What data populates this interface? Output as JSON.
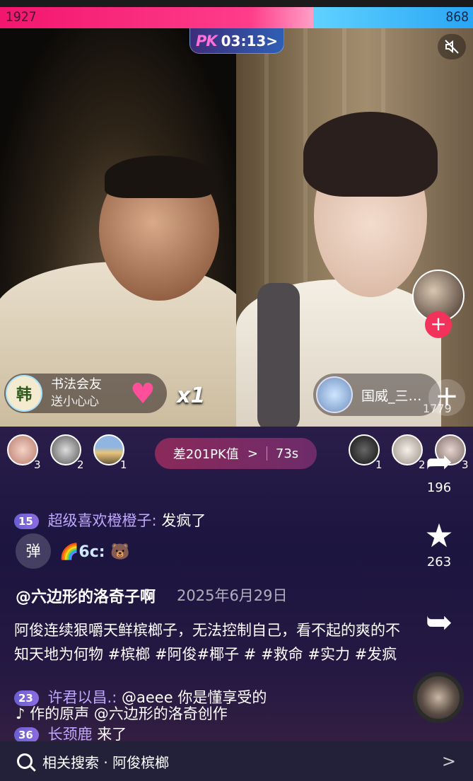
{
  "pk": {
    "left_score": "1927",
    "right_score": "868",
    "logo": "PK",
    "timer": "03:13>",
    "left_ratio": 0.662
  },
  "left_anchor": {
    "gift_sender": "书法会友",
    "gift_action": "送小心心",
    "gift_avatar_glyph": "韩",
    "gift_icon": "heart-gift-icon",
    "gift_count": "x1"
  },
  "right_anchor": {
    "name": "国威_三…",
    "side_count": "1779"
  },
  "fans": {
    "left": [
      {
        "rank": "3"
      },
      {
        "rank": "2"
      },
      {
        "rank": "1"
      }
    ],
    "right": [
      {
        "rank": "1"
      },
      {
        "rank": "2"
      },
      {
        "rank": "3"
      }
    ]
  },
  "pk_diff": {
    "text": "差201PK值",
    "chevron": ">",
    "countdown": "73s"
  },
  "comments": [
    {
      "level": "15",
      "user": "超级喜欢橙橙子:",
      "msg": "发疯了"
    },
    {
      "level": "23",
      "user": "许君以昌.:",
      "msg": "@aeee 你是懂享受的"
    },
    {
      "level": "36",
      "user": "长颈鹿",
      "msg": "来了"
    }
  ],
  "danmu_button": "弹",
  "emoji_line": "🌈6c: 🐻",
  "caption": {
    "author": "@六边形的洛奇子啊",
    "date": "2025年6月29日",
    "description": "阿俊连续狠嚼天鲜槟榔子，无法控制自己，看不起的爽的不知天地为何物 #槟榔 #阿俊#椰子 # #救命 #实力 #发疯",
    "music": "作的原声 @六边形的洛奇创作"
  },
  "actions": {
    "share_count": "196",
    "favorite_count": "263"
  },
  "search": {
    "label": "相关搜索 · 阿俊槟榔",
    "chevron": ">"
  },
  "icons": {
    "mute": "mute-icon",
    "star": "star-icon",
    "share": "share-arrow-icon"
  },
  "colors": {
    "pk_red": "#f2166e",
    "pk_blue": "#2aa5f5",
    "follow_red": "#f2325a"
  }
}
